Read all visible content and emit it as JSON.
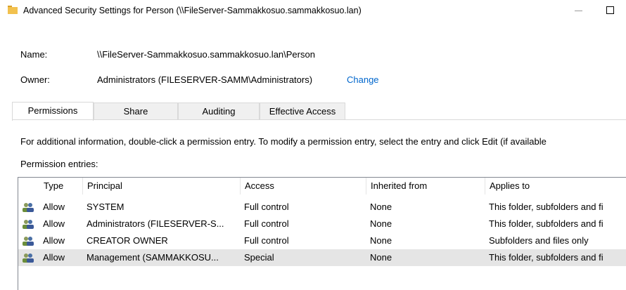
{
  "window": {
    "title": "Advanced Security Settings for Person (\\\\FileServer-Sammakkosuo.sammakkosuo.lan)"
  },
  "info": {
    "name_label": "Name:",
    "name_value": "\\\\FileServer-Sammakkosuo.sammakkosuo.lan\\Person",
    "owner_label": "Owner:",
    "owner_value": "Administrators (FILESERVER-SAMM\\Administrators)",
    "change_link": "Change"
  },
  "tabs": [
    {
      "label": "Permissions",
      "active": true
    },
    {
      "label": "Share",
      "active": false
    },
    {
      "label": "Auditing",
      "active": false
    },
    {
      "label": "Effective Access",
      "active": false
    }
  ],
  "description": "For additional information, double-click a permission entry. To modify a permission entry, select the entry and click Edit (if available",
  "entries_label": "Permission entries:",
  "columns": [
    "Type",
    "Principal",
    "Access",
    "Inherited from",
    "Applies to"
  ],
  "rows": [
    {
      "type": "Allow",
      "principal": "SYSTEM",
      "access": "Full control",
      "inherited": "None",
      "applies": "This folder, subfolders and fi",
      "selected": false
    },
    {
      "type": "Allow",
      "principal": "Administrators (FILESERVER-S...",
      "access": "Full control",
      "inherited": "None",
      "applies": "This folder, subfolders and fi",
      "selected": false
    },
    {
      "type": "Allow",
      "principal": "CREATOR OWNER",
      "access": "Full control",
      "inherited": "None",
      "applies": "Subfolders and files only",
      "selected": false
    },
    {
      "type": "Allow",
      "principal": "Management (SAMMAKKOSU...",
      "access": "Special",
      "inherited": "None",
      "applies": "This folder, subfolders and fi",
      "selected": true
    }
  ],
  "colors": {
    "link": "#0066cc",
    "selected_row": "#e5e5e5",
    "folder": "#e8b33a"
  },
  "icons": {
    "title": "folder-icon",
    "row": "users-icon"
  }
}
